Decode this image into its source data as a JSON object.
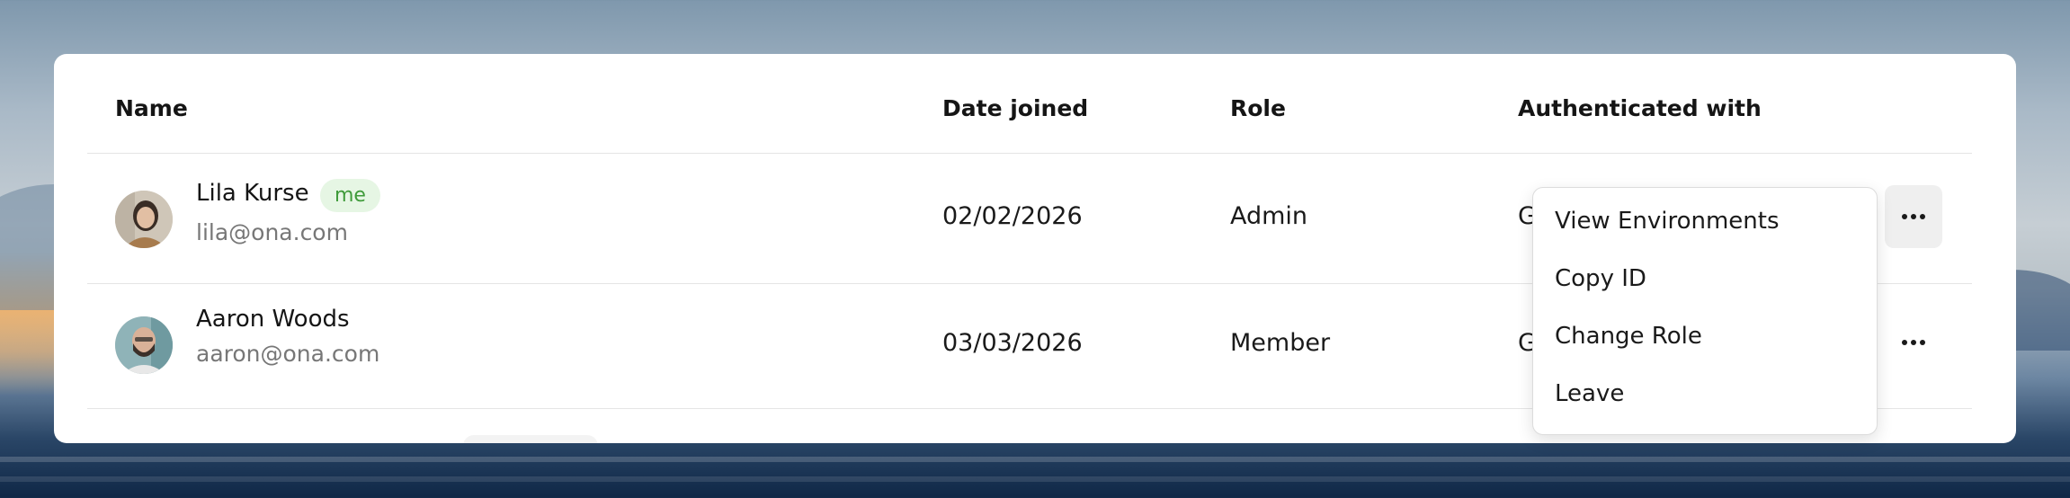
{
  "table": {
    "headers": {
      "name": "Name",
      "date_joined": "Date joined",
      "role": "Role",
      "authenticated_with": "Authenticated with"
    },
    "rows": [
      {
        "name": "Lila Kurse",
        "email": "lila@ona.com",
        "badge": "me",
        "date_joined": "02/02/2026",
        "role": "Admin",
        "auth_visible": "G"
      },
      {
        "name": "Aaron Woods",
        "email": "aaron@ona.com",
        "date_joined": "03/03/2026",
        "role": "Member",
        "auth_visible": "G"
      }
    ]
  },
  "context_menu": {
    "items": [
      "View Environments",
      "Copy ID",
      "Change Role",
      "Leave"
    ]
  },
  "icons": {
    "row_actions": "more-horizontal-icon"
  },
  "colors": {
    "badge_bg": "#e6f6e4",
    "badge_text": "#3f9b3a",
    "active_action_bg": "#efefef"
  }
}
